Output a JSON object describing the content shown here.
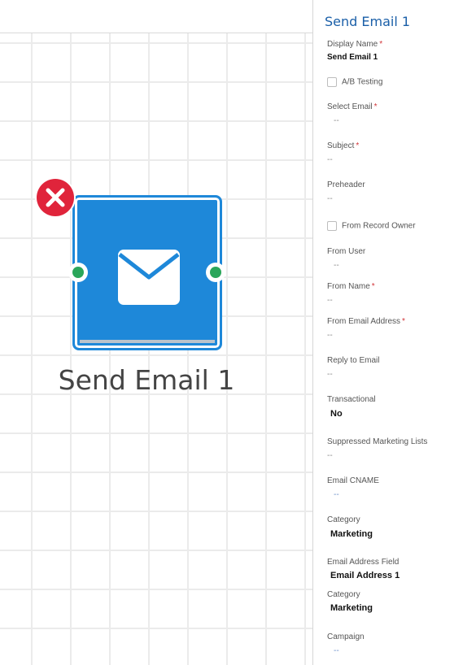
{
  "node": {
    "title": "Send Email 1",
    "colors": {
      "tile": "#1e88d9",
      "error": "#e0243b",
      "port": "#2aa65a"
    },
    "icons": {
      "main": "envelope-icon",
      "error": "error-x-icon"
    }
  },
  "panel": {
    "title": "Send Email 1",
    "display_name": {
      "label": "Display Name",
      "value": "Send Email 1"
    },
    "ab_testing": {
      "label": "A/B Testing"
    },
    "select_email": {
      "label": "Select Email",
      "value": "--"
    },
    "subject": {
      "label": "Subject",
      "value": "--"
    },
    "preheader": {
      "label": "Preheader",
      "value": "--"
    },
    "from_record_owner": {
      "label": "From Record Owner"
    },
    "from_user": {
      "label": "From User",
      "value": "--"
    },
    "from_name": {
      "label": "From Name",
      "value": "--"
    },
    "from_email_address": {
      "label": "From Email Address",
      "value": "--"
    },
    "reply_to_email": {
      "label": "Reply to Email",
      "value": "--"
    },
    "transactional": {
      "label": "Transactional",
      "value": "No"
    },
    "suppressed_lists": {
      "label": "Suppressed Marketing Lists",
      "value": "--"
    },
    "email_cname": {
      "label": "Email CNAME",
      "value": "--"
    },
    "category_1": {
      "label": "Category",
      "value": "Marketing"
    },
    "email_address_field": {
      "label": "Email Address Field",
      "value": "Email Address 1"
    },
    "category_2": {
      "label": "Category",
      "value": "Marketing"
    },
    "campaign": {
      "label": "Campaign",
      "value": "--"
    },
    "required_marker": "*"
  }
}
